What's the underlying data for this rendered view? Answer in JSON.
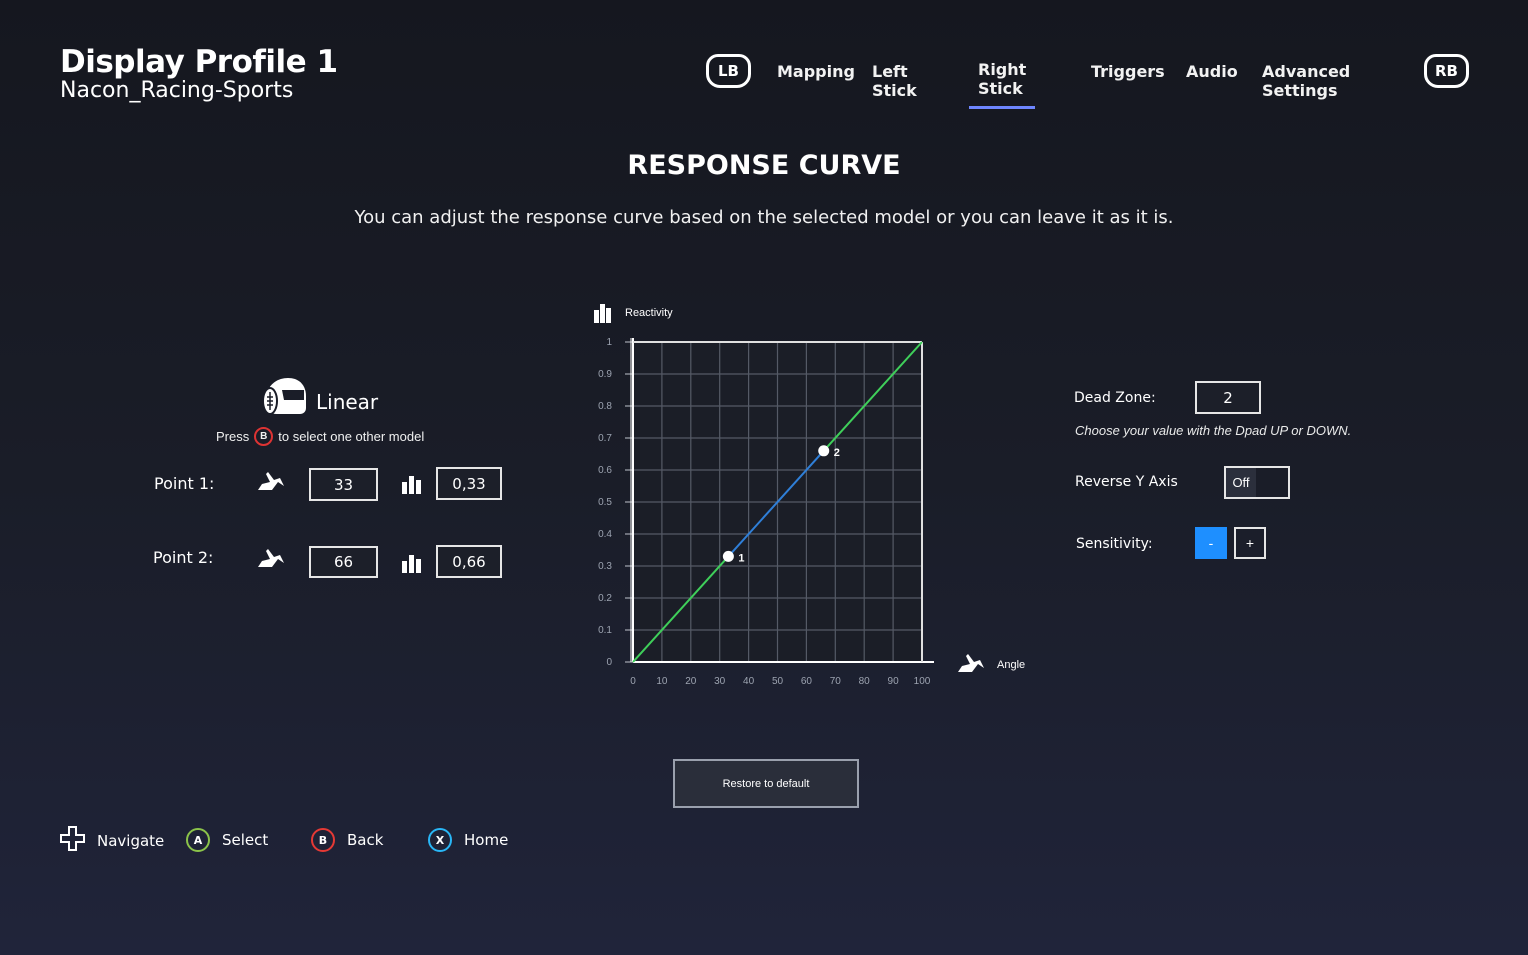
{
  "profile": {
    "title": "Display Profile 1",
    "subtitle": "Nacon_Racing-Sports"
  },
  "nav": {
    "left_bumper": "LB",
    "right_bumper": "RB",
    "tabs": [
      {
        "label": "Mapping",
        "active": false
      },
      {
        "label": "Left Stick",
        "active": false
      },
      {
        "label": "Right Stick",
        "active": true
      },
      {
        "label": "Triggers",
        "active": false
      },
      {
        "label": "Audio",
        "active": false
      },
      {
        "label": "Advanced Settings",
        "active": false
      }
    ],
    "active_color": "#6e86ff"
  },
  "section": {
    "title": "RESPONSE CURVE",
    "description": "You can adjust the response curve based on the selected model or you can leave it as it is."
  },
  "model": {
    "icon": "helmet-icon",
    "name": "Linear",
    "hint_prefix": "Press",
    "hint_button": "B",
    "hint_suffix": "to select one other model"
  },
  "points": [
    {
      "label": "Point 1:",
      "angle": "33",
      "reactivity": "0,33",
      "angle_icon": "angle-icon",
      "reactivity_icon": "reactivity-icon"
    },
    {
      "label": "Point 2:",
      "angle": "66",
      "reactivity": "0,66",
      "angle_icon": "angle-icon",
      "reactivity_icon": "reactivity-icon"
    }
  ],
  "settings": {
    "dead_zone_label": "Dead Zone:",
    "dead_zone_value": "2",
    "dead_zone_hint": "Choose your value with the Dpad UP or DOWN.",
    "reverse_label": "Reverse Y Axis",
    "reverse_value": "Off",
    "sensitivity_label": "Sensitivity:",
    "minus": "-",
    "plus": "+",
    "accent_color": "#1e8fff"
  },
  "restore_label": "Restore to default",
  "footer": [
    {
      "label": "Navigate",
      "button": "",
      "icon": "dpad-icon"
    },
    {
      "label": "Select",
      "button": "A",
      "color": "#8bc34a"
    },
    {
      "label": "Back",
      "button": "B",
      "color": "#e53935"
    },
    {
      "label": "Home",
      "button": "X",
      "color": "#29b6f6"
    }
  ],
  "chart_data": {
    "type": "line",
    "ylabel": "Reactivity",
    "xlabel": "Angle",
    "xlim": [
      0,
      100
    ],
    "ylim": [
      0,
      1
    ],
    "x_ticks": [
      "0",
      "10",
      "20",
      "30",
      "40",
      "50",
      "60",
      "70",
      "80",
      "90",
      "100"
    ],
    "y_ticks": [
      "0",
      "0.1",
      "0.2",
      "0.3",
      "0.4",
      "0.5",
      "0.6",
      "0.7",
      "0.8",
      "0.9",
      "1"
    ],
    "grid": true,
    "series": [
      {
        "x": [
          0,
          33
        ],
        "y": [
          0,
          0.33
        ],
        "color": "#3fcf5a"
      },
      {
        "x": [
          33,
          66
        ],
        "y": [
          0.33,
          0.66
        ],
        "color": "#2f7fd8"
      },
      {
        "x": [
          66,
          100
        ],
        "y": [
          0.66,
          1
        ],
        "color": "#3fcf5a"
      }
    ],
    "points": [
      {
        "label": "1",
        "x": 33,
        "y": 0.33
      },
      {
        "label": "2",
        "x": 66,
        "y": 0.66
      }
    ]
  }
}
